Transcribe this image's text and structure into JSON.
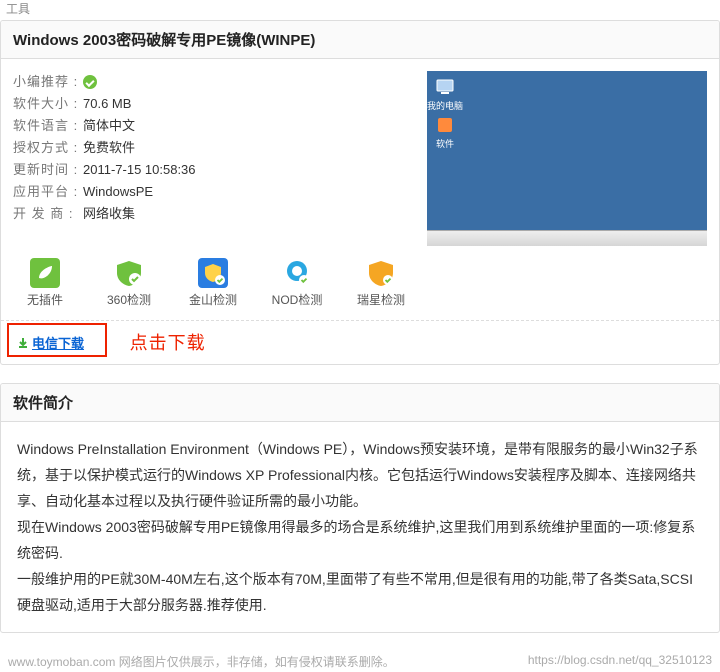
{
  "crumb": "工具",
  "title": "Windows 2003密码破解专用PE镜像(WINPE)",
  "info": {
    "label_recommend": "小编推荐 :",
    "label_size": "软件大小 :",
    "size": "70.6 MB",
    "label_lang": "软件语言 :",
    "lang": "简体中文",
    "label_license": "授权方式 :",
    "license": "免费软件",
    "label_updated": "更新时间 :",
    "updated": "2011-7-15 10:58:36",
    "label_platform": "应用平台 :",
    "platform": "WindowsPE",
    "label_dev": "开 发 商 :",
    "dev": "网络收集"
  },
  "shot": {
    "icon1": "我的电脑",
    "icon2": "软件"
  },
  "checks": [
    {
      "name": "无插件"
    },
    {
      "name": "360检测"
    },
    {
      "name": "金山检测"
    },
    {
      "name": "NOD检测"
    },
    {
      "name": "瑞星检测"
    }
  ],
  "download": {
    "label": "电信下载",
    "hint": "点击下载"
  },
  "desc": {
    "header": "软件简介",
    "p1": "Windows PreInstallation Environment（Windows PE），Windows预安装环境，是带有限服务的最小Win32子系统，基于以保护模式运行的Windows XP Professional内核。它包括运行Windows安装程序及脚本、连接网络共享、自动化基本过程以及执行硬件验证所需的最小功能。",
    "p2": "现在Windows 2003密码破解专用PE镜像用得最多的场合是系统维护,这里我们用到系统维护里面的一项:修复系统密码.",
    "p3": "一般维护用的PE就30M-40M左右,这个版本有70M,里面带了有些不常用,但是很有用的功能,带了各类Sata,SCSI硬盘驱动,适用于大部分服务器.推荐使用."
  },
  "footer": {
    "left": "www.toymoban.com 网络图片仅供展示，非存储，如有侵权请联系删除。",
    "right": "https://blog.csdn.net/qq_32510123"
  }
}
